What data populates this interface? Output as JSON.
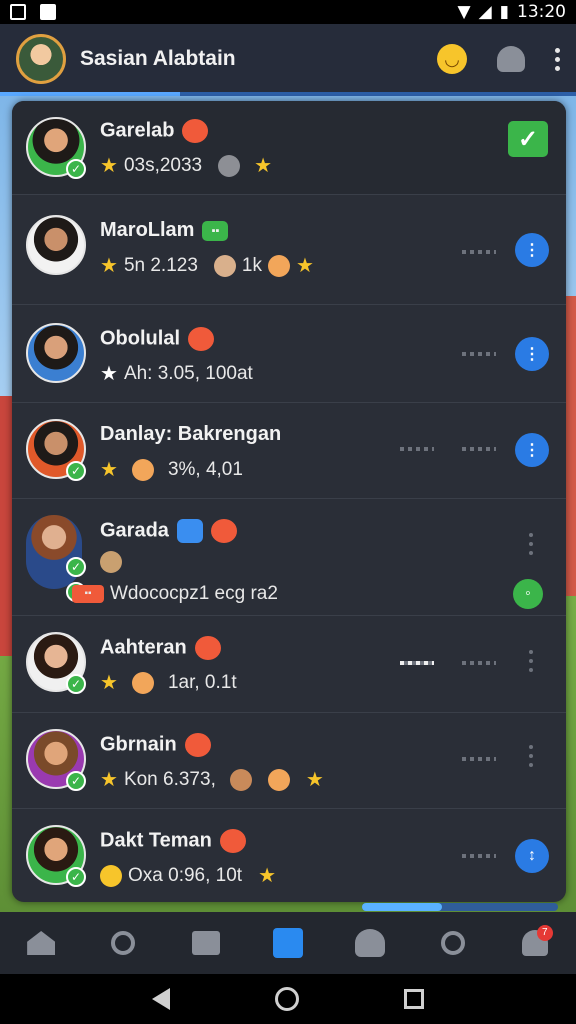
{
  "status": {
    "time": "13:20"
  },
  "header": {
    "title": "Sasian Alabtain"
  },
  "contacts": [
    {
      "name": "Garelab",
      "meta": "03s,2033",
      "badge": "red"
    },
    {
      "name": "MaroLlam",
      "meta": "5n 2.123",
      "extra": "1k",
      "badge": "green"
    },
    {
      "name": "Obolulal",
      "meta": "Ah: 3.05, 100at",
      "badge": "red"
    },
    {
      "name": "Danlay: Bakrengan",
      "meta": "3%, 4,01",
      "badge": "none"
    },
    {
      "name": "Garada",
      "meta": "Wdococpz1 ecg ra2",
      "badge": "blue"
    },
    {
      "name": "Aahteran",
      "meta": "1ar, 0.1t",
      "badge": "red"
    },
    {
      "name": "Gbrnain",
      "meta": "Kon 6.373,",
      "badge": "red"
    },
    {
      "name": "Dakt Teman",
      "meta": "Oxa 0:96, 10t",
      "badge": "red"
    }
  ],
  "colors": {
    "accent": "#2a7be4",
    "online": "#3bb54a",
    "star": "#f7c52b"
  },
  "tabbar": {
    "notification_count": "7"
  }
}
